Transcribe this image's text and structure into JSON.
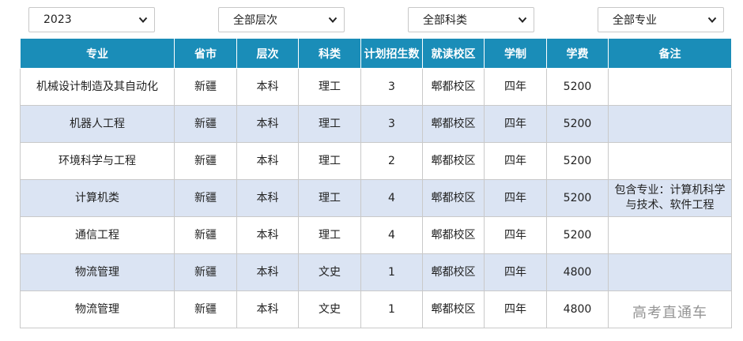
{
  "filters": {
    "year": "2023",
    "level": "全部层次",
    "category": "全部科类",
    "major": "全部专业"
  },
  "table": {
    "headers": [
      "专业",
      "省市",
      "层次",
      "科类",
      "计划招生数",
      "就读校区",
      "学制",
      "学费",
      "备注"
    ],
    "rows": [
      [
        "机械设计制造及其自动化",
        "新疆",
        "本科",
        "理工",
        "3",
        "郫都校区",
        "四年",
        "5200",
        ""
      ],
      [
        "机器人工程",
        "新疆",
        "本科",
        "理工",
        "3",
        "郫都校区",
        "四年",
        "5200",
        ""
      ],
      [
        "环境科学与工程",
        "新疆",
        "本科",
        "理工",
        "2",
        "郫都校区",
        "四年",
        "5200",
        ""
      ],
      [
        "计算机类",
        "新疆",
        "本科",
        "理工",
        "4",
        "郫都校区",
        "四年",
        "5200",
        "包含专业：计算机科学与技术、软件工程"
      ],
      [
        "通信工程",
        "新疆",
        "本科",
        "理工",
        "4",
        "郫都校区",
        "四年",
        "5200",
        ""
      ],
      [
        "物流管理",
        "新疆",
        "本科",
        "文史",
        "1",
        "郫都校区",
        "四年",
        "4800",
        ""
      ],
      [
        "物流管理",
        "新疆",
        "本科",
        "文史",
        "1",
        "郫都校区",
        "四年",
        "4800",
        ""
      ]
    ]
  },
  "colors": {
    "header_bg": "#1a8db8",
    "alt_row_bg": "#dbe4f3"
  },
  "watermark": "高考直通车"
}
